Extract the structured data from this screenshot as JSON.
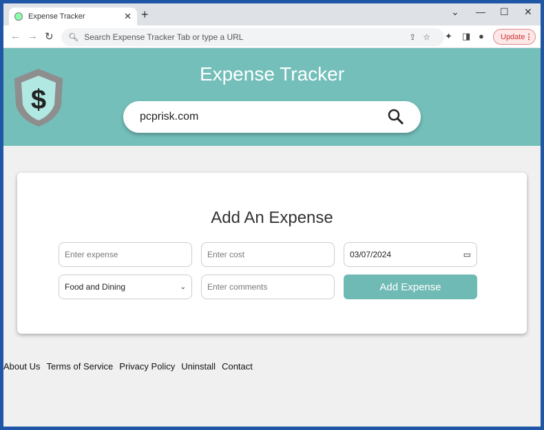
{
  "browser": {
    "tab_title": "Expense Tracker",
    "omnibox_placeholder": "Search Expense Tracker Tab or type a URL",
    "update_label": "Update"
  },
  "header": {
    "title": "Expense Tracker",
    "search_value": "pcprisk.com"
  },
  "form": {
    "title": "Add An Expense",
    "expense_placeholder": "Enter expense",
    "cost_placeholder": "Enter cost",
    "date_value": "03/07/2024",
    "category_value": "Food and Dining",
    "comments_placeholder": "Enter comments",
    "submit_label": "Add Expense"
  },
  "footer": {
    "links": [
      "About Us",
      "Terms of Service",
      "Privacy Policy",
      "Uninstall",
      "Contact"
    ]
  },
  "colors": {
    "accent": "#74bfba",
    "button": "#6fbab5"
  }
}
